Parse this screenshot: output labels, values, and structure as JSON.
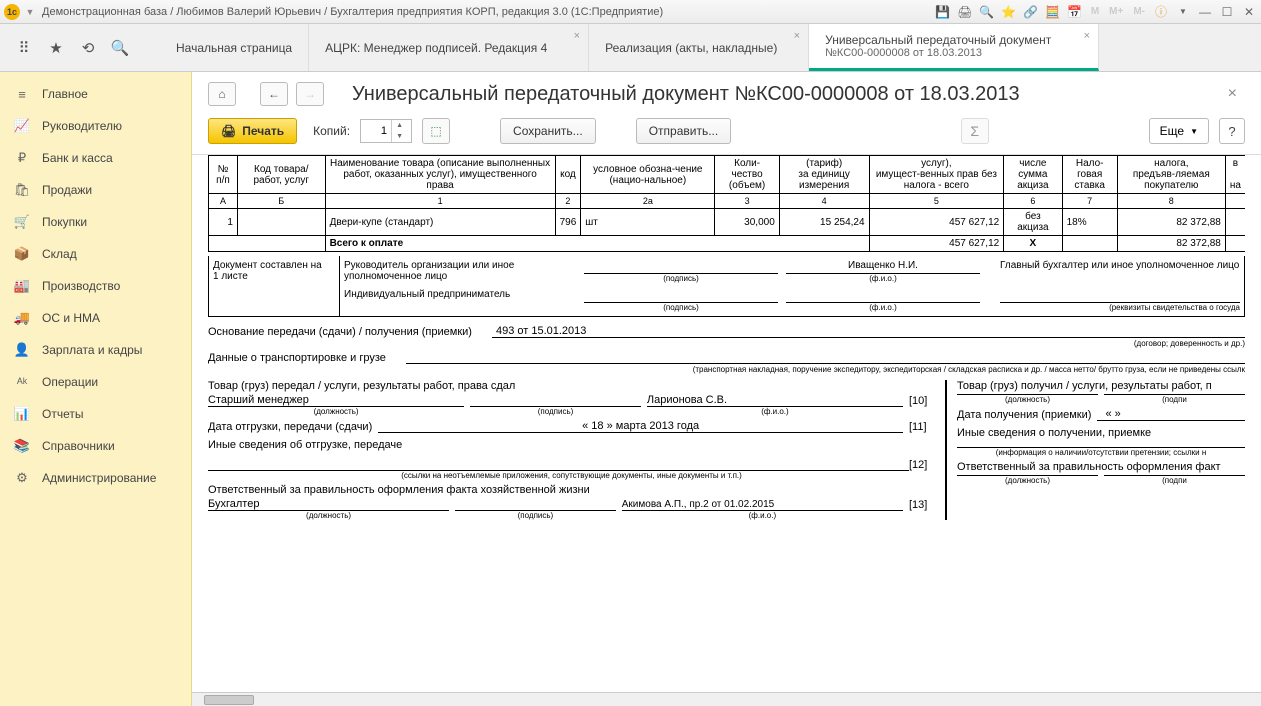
{
  "title": "Демонстрационная база / Любимов Валерий Юрьевич / Бухгалтерия предприятия КОРП, редакция 3.0  (1С:Предприятие)",
  "tabs": {
    "home": "Начальная страница",
    "t1": "АЦРК: Менеджер подписей. Редакция 4",
    "t2": "Реализация (акты, накладные)",
    "t3_l1": "Универсальный передаточный документ",
    "t3_l2": "№КС00-0000008 от 18.03.2013"
  },
  "sidebar": [
    {
      "icon": "≡",
      "label": "Главное"
    },
    {
      "icon": "📈",
      "label": "Руководителю"
    },
    {
      "icon": "₽",
      "label": "Банк и касса"
    },
    {
      "icon": "🛍",
      "label": "Продажи"
    },
    {
      "icon": "🛒",
      "label": "Покупки"
    },
    {
      "icon": "📦",
      "label": "Склад"
    },
    {
      "icon": "🏭",
      "label": "Производство"
    },
    {
      "icon": "🚚",
      "label": "ОС и НМА"
    },
    {
      "icon": "👤",
      "label": "Зарплата и кадры"
    },
    {
      "icon": "ᴬᵏ",
      "label": "Операции"
    },
    {
      "icon": "📊",
      "label": "Отчеты"
    },
    {
      "icon": "📚",
      "label": "Справочники"
    },
    {
      "icon": "⚙",
      "label": "Администрирование"
    }
  ],
  "doc_title": "Универсальный передаточный документ №КС00-0000008 от 18.03.2013",
  "toolbar": {
    "print": "Печать",
    "copies_label": "Копий:",
    "copies_value": "1",
    "save": "Сохранить...",
    "send": "Отправить...",
    "more": "Еще"
  },
  "grid": {
    "h_num": "№ п/п",
    "h_code": "Код товара/ работ, услуг",
    "h_name": "Наименование товара (описание выполненных работ, оказанных услуг), имущественного права",
    "h_kod": "код",
    "h_unit": "условное обозна-чение (нацио-нальное)",
    "h_qty_top": "Коли-",
    "h_qty": "чество (объем)",
    "h_price_top": "(тариф)",
    "h_price": "за единицу измерения",
    "h_sum_top": "услуг),",
    "h_sum": "имущест-венных прав без налога - всего",
    "h_excise_top": "числе",
    "h_excise": "сумма акциза",
    "h_rate_top": "Нало-",
    "h_rate": "говая ставка",
    "h_buyer_top": "налога,",
    "h_buyer": "предъяв-ляемая покупателю",
    "h_last1": "в",
    "h_last2": "на",
    "idx": {
      "a": "А",
      "b": "Б",
      "c1": "1",
      "c2": "2",
      "c2a": "2а",
      "c3": "3",
      "c4": "4",
      "c5": "5",
      "c6": "6",
      "c7": "7",
      "c8": "8"
    },
    "row": {
      "n": "1",
      "code": "",
      "name": "Двери-купе (стандарт)",
      "kod": "796",
      "unit": "шт",
      "qty": "30,000",
      "price": "15 254,24",
      "sum": "457 627,12",
      "excise": "без акциза",
      "rate": "18%",
      "buyer": "82 372,88"
    },
    "total_label": "Всего к оплате",
    "total_sum": "457 627,12",
    "total_x": "Х",
    "total_buyer": "82 372,88"
  },
  "form": {
    "doc_comp": "Документ составлен на",
    "sheets": "1 листе",
    "ruk": "Руководитель организации или иное уполномоченное лицо",
    "ruk_name": "Иващенко Н.И.",
    "glav": "Главный бухгалтер или иное уполномоченное лицо",
    "ip": "Индивидуальный предприниматель",
    "podpis": "(подпись)",
    "fio": "(ф.и.о.)",
    "rekvizity": "(реквизиты свидетельства о госуда",
    "osnovanie": "Основание передачи (сдачи) / получения (приемки)",
    "osnovanie_val": "493 от 15.01.2013",
    "osn_note": "(договор; доверенность и др.)",
    "transport": "Данные о транспортировке и грузе",
    "trans_note": "(транспортная накладная, поручение экспедитору, экспедиторская / складская расписка и др. / масса нетто/ брутто груза, если не приведены ссылк",
    "tovar_left": "Товар (груз) передал / услуги, результаты работ, права сдал",
    "tovar_right": "Товар (груз) получил / услуги, результаты работ, п",
    "dolzhnost": "(должность)",
    "position_left": "Старший менеджер",
    "fio_left": "Ларионова С.В.",
    "n10": "[10]",
    "date_left": "Дата отгрузки, передачи (сдачи)",
    "date_val": "« 18 »       марта     2013   года",
    "n11": "[11]",
    "date_right": "Дата получения (приемки)",
    "date_right_val": "«         »",
    "inye_left": "Иные сведения об отгрузке, передаче",
    "inye_right": "Иные сведения о получении, приемке",
    "n12": "[12]",
    "ssylki_left": "(ссылки на неотъемлемые приложения, сопутствующие документы, иные документы и т.п.)",
    "ssylki_right": "(информация о наличии/отсутствии претензии; ссылки н",
    "otv_left": "Ответственный за правильность оформления факта хозяйственной жизни",
    "otv_right": "Ответственный за правильность оформления факт",
    "buh": "Бухгалтер",
    "akimova": "Акимова А.П., пр.2 от 01.02.2015",
    "n13": "[13]",
    "podpi": "(подпи"
  }
}
